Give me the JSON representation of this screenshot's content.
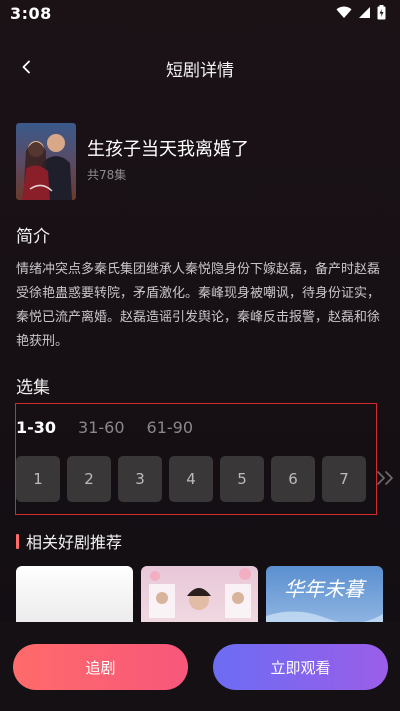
{
  "status": {
    "time": "3:08"
  },
  "header": {
    "title": "短剧详情"
  },
  "drama": {
    "title": "生孩子当天我离婚了",
    "episode_count": "共78集"
  },
  "synopsis": {
    "heading": "简介",
    "text": "情绪冲突点多秦氏集团继承人秦悦隐身份下嫁赵磊，备产时赵磊受徐艳蛊惑要转院，矛盾激化。秦峰现身被嘲讽，待身份证实，秦悦已流产离婚。赵磊造谣引发舆论，秦峰反击报警，赵磊和徐艳获刑。"
  },
  "episodes": {
    "heading": "选集",
    "tabs": [
      {
        "label": "1-30"
      },
      {
        "label": "31-60"
      },
      {
        "label": "61-90"
      }
    ],
    "active_tab": "1-30",
    "items": [
      {
        "label": "1"
      },
      {
        "label": "2"
      },
      {
        "label": "3"
      },
      {
        "label": "4"
      },
      {
        "label": "5"
      },
      {
        "label": "6"
      },
      {
        "label": "7"
      }
    ]
  },
  "related": {
    "heading": "相关好剧推荐",
    "third_poster_text": "华年未暮"
  },
  "actions": {
    "follow_label": "追剧",
    "watch_label": "立即观看"
  },
  "colors": {
    "follow_gradient": [
      "#ff6b6b",
      "#f7577a"
    ],
    "watch_gradient": [
      "#6c6cf3",
      "#9b5ee9"
    ],
    "highlight_border": "#d12c2c"
  }
}
